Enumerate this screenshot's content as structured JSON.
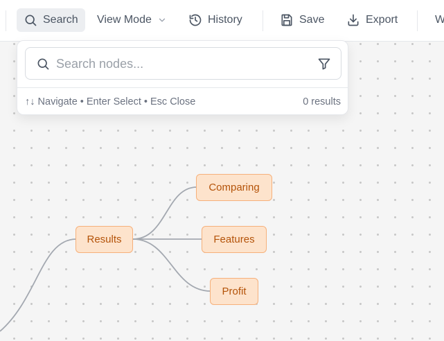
{
  "toolbar": {
    "search_label": "Search",
    "view_mode_label": "View Mode",
    "history_label": "History",
    "save_label": "Save",
    "export_label": "Export",
    "cut_label": "W"
  },
  "search_panel": {
    "placeholder": "Search nodes...",
    "value": "",
    "hint": "↑↓ Navigate • Enter Select • Esc Close",
    "results": "0 results"
  },
  "mindmap": {
    "nodes": [
      {
        "id": "results",
        "label": "Results"
      },
      {
        "id": "comparing",
        "label": "Comparing"
      },
      {
        "id": "features",
        "label": "Features"
      },
      {
        "id": "profit",
        "label": "Profit"
      }
    ]
  },
  "colors": {
    "node_fill": "#fde3cc",
    "node_border": "#f6b07a",
    "node_text": "#b45309",
    "edge": "#a3a8b0"
  }
}
